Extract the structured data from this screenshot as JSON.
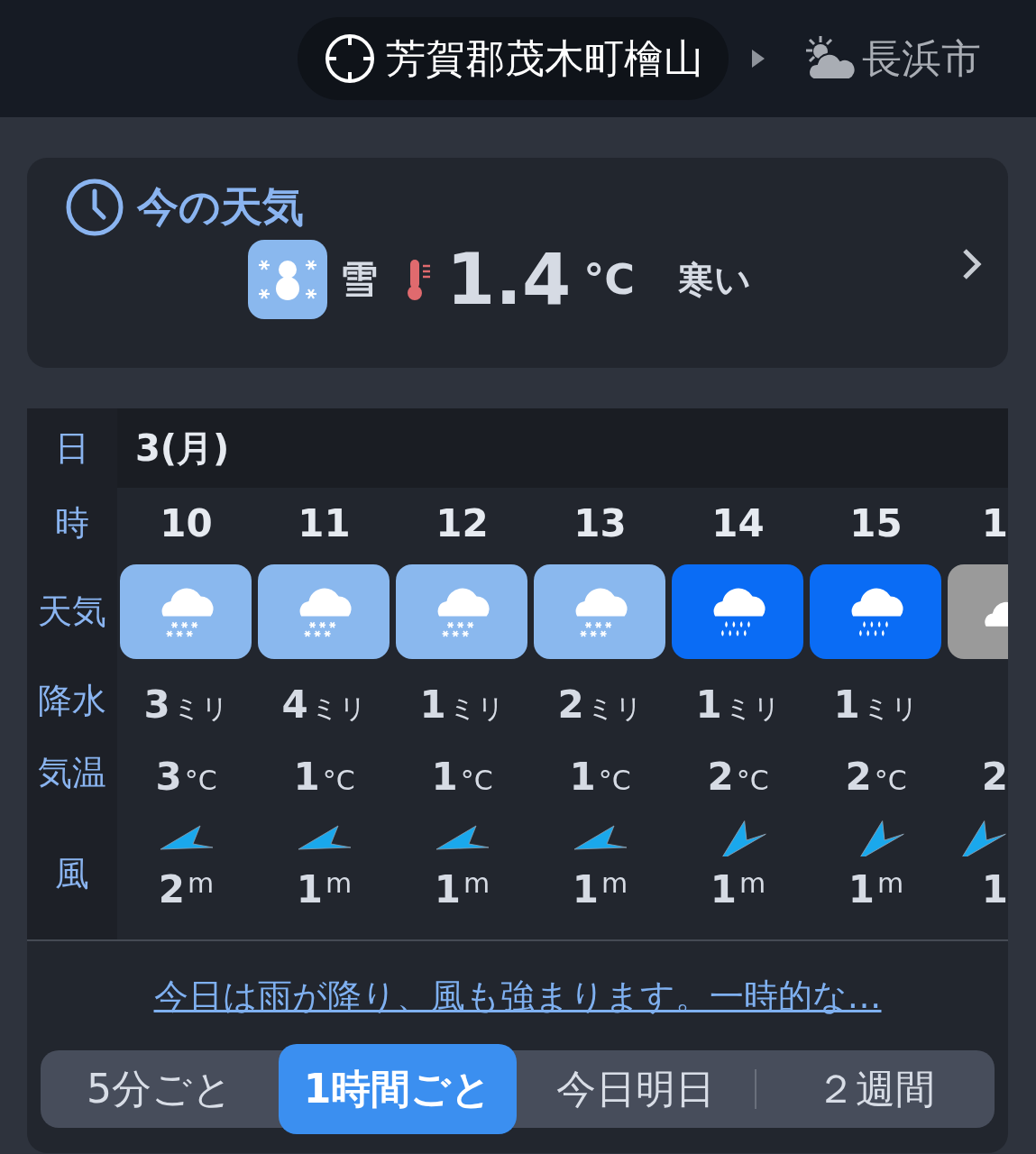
{
  "header": {
    "location": "芳賀郡茂木町檜山",
    "next_location": "長浜市"
  },
  "current": {
    "title": "今の天気",
    "weather": "雪",
    "kind": "snow",
    "temperature": "1.4",
    "unit": "°C",
    "feeling": "寒い"
  },
  "table": {
    "labels": {
      "day": "日",
      "hour": "時",
      "weather": "天気",
      "precip": "降水",
      "temp": "気温",
      "wind": "風"
    },
    "date": "3(月)",
    "columns": [
      {
        "hour": "10",
        "kind": "snow",
        "precip": "3",
        "precip_unit": "ミリ",
        "temp": "3",
        "temp_unit": "°C",
        "wind": {
          "kind": "ene",
          "speed": "2",
          "unit": "m"
        }
      },
      {
        "hour": "11",
        "kind": "snow",
        "precip": "4",
        "precip_unit": "ミリ",
        "temp": "1",
        "temp_unit": "°C",
        "wind": {
          "kind": "ene",
          "speed": "1",
          "unit": "m"
        }
      },
      {
        "hour": "12",
        "kind": "snow",
        "precip": "1",
        "precip_unit": "ミリ",
        "temp": "1",
        "temp_unit": "°C",
        "wind": {
          "kind": "ene",
          "speed": "1",
          "unit": "m"
        }
      },
      {
        "hour": "13",
        "kind": "snow",
        "precip": "2",
        "precip_unit": "ミリ",
        "temp": "1",
        "temp_unit": "°C",
        "wind": {
          "kind": "ene",
          "speed": "1",
          "unit": "m"
        }
      },
      {
        "hour": "14",
        "kind": "rain",
        "precip": "1",
        "precip_unit": "ミリ",
        "temp": "2",
        "temp_unit": "°C",
        "wind": {
          "kind": "ne",
          "speed": "1",
          "unit": "m"
        }
      },
      {
        "hour": "15",
        "kind": "rain",
        "precip": "1",
        "precip_unit": "ミリ",
        "temp": "2",
        "temp_unit": "°C",
        "wind": {
          "kind": "ne",
          "speed": "1",
          "unit": "m"
        }
      },
      {
        "hour": "1",
        "kind": "cloudy",
        "temp": "2",
        "wind": {
          "kind": "ne",
          "speed": "1"
        }
      }
    ]
  },
  "summary_link": "今日は雨が降り、風も強まります。一時的な…",
  "segments": [
    {
      "label": "5分ごと",
      "selected": false
    },
    {
      "label": "1時間ごと",
      "selected": true
    },
    {
      "label": "今日明日",
      "selected": false
    },
    {
      "label": "２週間",
      "selected": false
    }
  ]
}
